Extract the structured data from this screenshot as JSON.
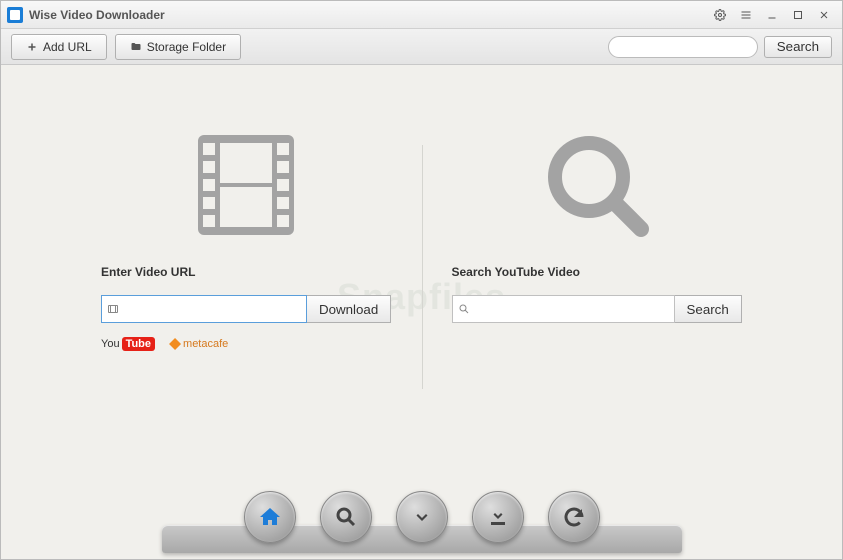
{
  "titlebar": {
    "app_title": "Wise Video Downloader"
  },
  "toolbar": {
    "add_url_label": "Add URL",
    "storage_folder_label": "Storage Folder",
    "search_button_label": "Search",
    "search_value": ""
  },
  "main": {
    "left": {
      "section_label": "Enter Video URL",
      "input_value": "",
      "download_button_label": "Download",
      "brands": {
        "youtube_prefix": "You",
        "youtube_box": "Tube",
        "metacafe": "metacafe"
      }
    },
    "right": {
      "section_label": "Search YouTube Video",
      "input_value": "",
      "search_button_label": "Search"
    }
  },
  "dock": {
    "items": [
      {
        "name": "home"
      },
      {
        "name": "search"
      },
      {
        "name": "download"
      },
      {
        "name": "download-to-folder"
      },
      {
        "name": "refresh"
      }
    ]
  },
  "watermark": "Snapfiles",
  "icons": {
    "settings": "settings-icon",
    "menu": "menu-icon",
    "minimize": "minimize-icon",
    "maximize": "maximize-icon",
    "close": "close-icon"
  }
}
